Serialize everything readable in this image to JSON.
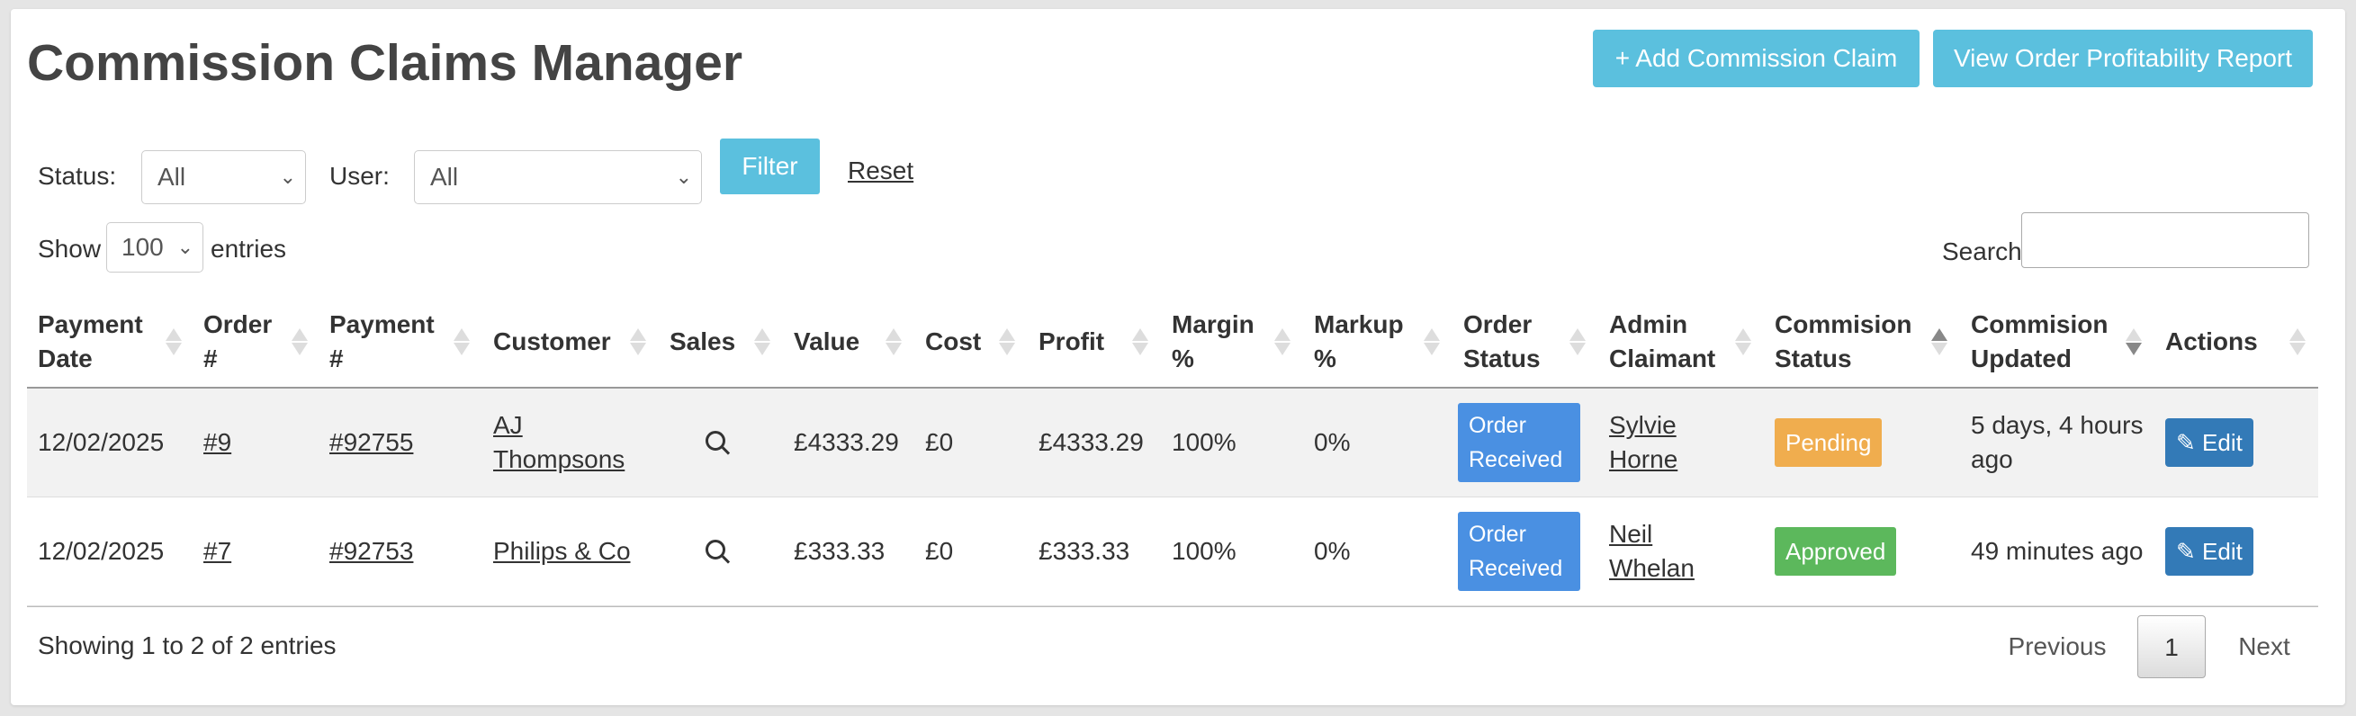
{
  "page": {
    "title": "Commission Claims Manager",
    "add_button": "+ Add Commission Claim",
    "report_button": "View Order Profitability Report"
  },
  "filters": {
    "status_label": "Status:",
    "status_value": "All",
    "user_label": "User:",
    "user_value": "All",
    "filter_button": "Filter",
    "reset_link": "Reset"
  },
  "length": {
    "show_label": "Show",
    "value": "100",
    "entries_label": "entries"
  },
  "search": {
    "label": "Search:",
    "value": ""
  },
  "table": {
    "columns": [
      {
        "label": "Payment Date",
        "sort": "none"
      },
      {
        "label": "Order #",
        "sort": "none"
      },
      {
        "label": "Payment #",
        "sort": "none"
      },
      {
        "label": "Customer",
        "sort": "none"
      },
      {
        "label": "Sales",
        "sort": "none"
      },
      {
        "label": "Value",
        "sort": "none"
      },
      {
        "label": "Cost",
        "sort": "none"
      },
      {
        "label": "Profit",
        "sort": "none"
      },
      {
        "label": "Margin %",
        "sort": "none"
      },
      {
        "label": "Markup %",
        "sort": "none"
      },
      {
        "label": "Order Status",
        "sort": "none"
      },
      {
        "label": "Admin Claimant",
        "sort": "none"
      },
      {
        "label": "Commision Status",
        "sort": "asc"
      },
      {
        "label": "Commision Updated",
        "sort": "desc"
      },
      {
        "label": "Actions",
        "sort": "none"
      }
    ],
    "rows": [
      {
        "payment_date": "12/02/2025",
        "order": "#9",
        "payment": "#92755",
        "customer": "AJ Thompsons",
        "sales_icon": "search-icon",
        "value": "£4333.29",
        "cost": "£0",
        "profit": "£4333.29",
        "margin": "100%",
        "markup": "0%",
        "order_status": "Order Received",
        "admin_claimant": "Sylvie Horne",
        "commission_status": "Pending",
        "commission_updated": "5 days, 4 hours ago",
        "action": "Edit"
      },
      {
        "payment_date": "12/02/2025",
        "order": "#7",
        "payment": "#92753",
        "customer": "Philips & Co",
        "sales_icon": "search-icon",
        "value": "£333.33",
        "cost": "£0",
        "profit": "£333.33",
        "margin": "100%",
        "markup": "0%",
        "order_status": "Order Received",
        "admin_claimant": "Neil Whelan",
        "commission_status": "Approved",
        "commission_updated": "49 minutes ago",
        "action": "Edit"
      }
    ]
  },
  "footer": {
    "info": "Showing 1 to 2 of 2 entries",
    "previous": "Previous",
    "current_page": "1",
    "next": "Next"
  },
  "colors": {
    "accent": "#5bc0de",
    "order_status_badge": "#4a90e2",
    "pending": "#f0ad4e",
    "approved": "#5cb85c",
    "edit_button": "#337ab7"
  }
}
